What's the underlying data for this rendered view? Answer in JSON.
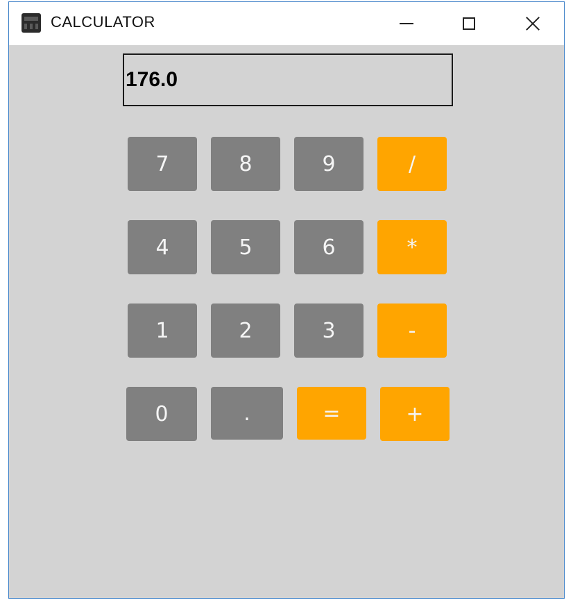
{
  "window": {
    "title": "CALCULATOR",
    "icon": "calculator-app-icon",
    "controls": [
      "minimize-icon",
      "maximize-icon",
      "close-icon"
    ]
  },
  "display": {
    "value": "176.0"
  },
  "keys": {
    "k7": "7",
    "k8": "8",
    "k9": "9",
    "div": "/",
    "k4": "4",
    "k5": "5",
    "k6": "6",
    "mul": "*",
    "k1": "1",
    "k2": "2",
    "k3": "3",
    "sub": "-",
    "k0": "0",
    "dot": ".",
    "eq": "=",
    "add": "+"
  },
  "colors": {
    "number_key": "#808080",
    "operator_key": "#ffa500",
    "background": "#d3d3d3",
    "key_text": "#f5f5f5"
  }
}
